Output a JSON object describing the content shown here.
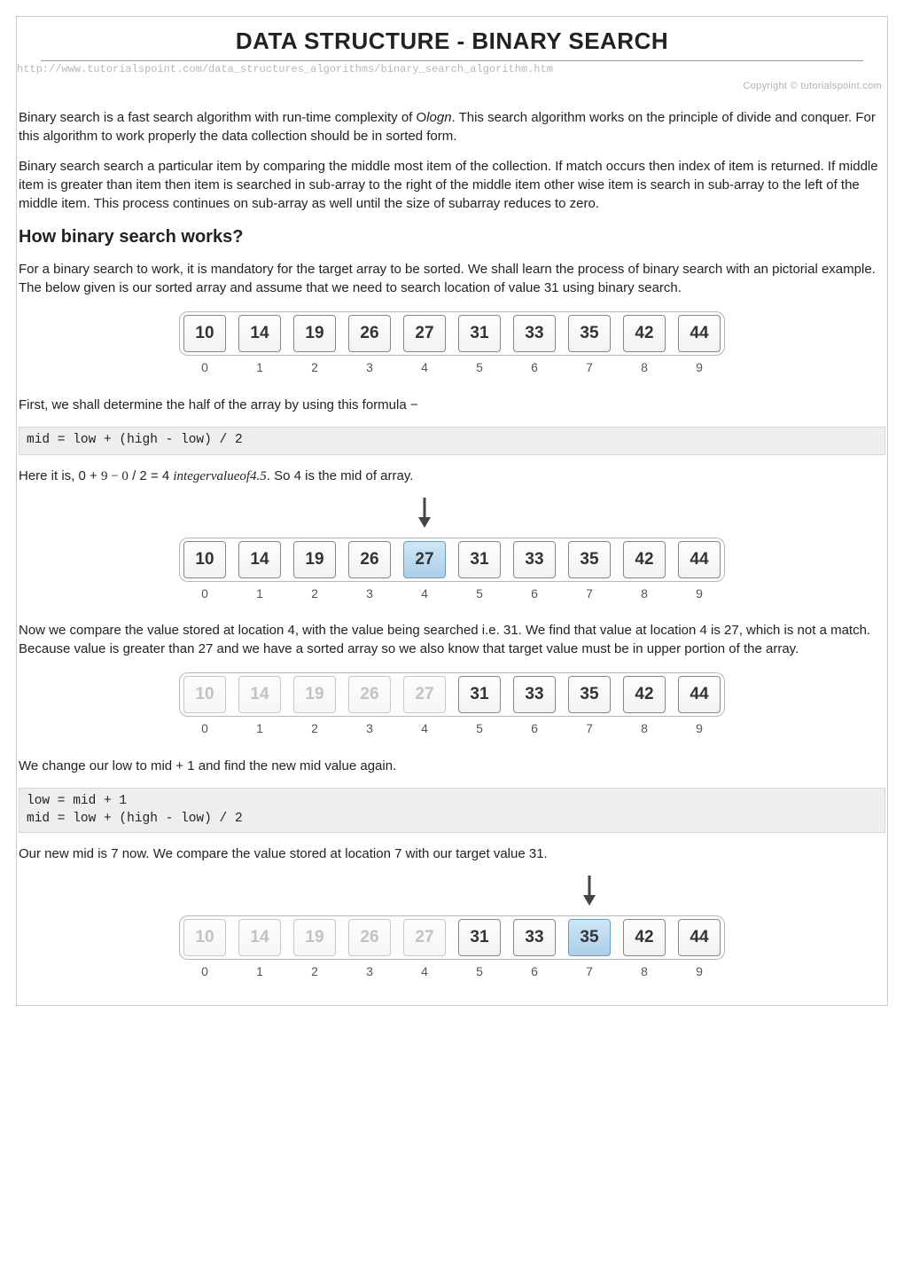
{
  "title": "DATA STRUCTURE - BINARY SEARCH",
  "url": "http://www.tutorialspoint.com/data_structures_algorithms/binary_search_algorithm.htm",
  "copyright": "Copyright © tutorialspoint.com",
  "p1a": "Binary search is a fast search algorithm with run-time complexity of Ο",
  "p1b": "logn",
  "p1c": ". This search algorithm works on the principle of divide and conquer. For this algorithm to work properly the data collection should be in sorted form.",
  "p2": "Binary search search a particular item by comparing the middle most item of the collection. If match occurs then index of item is returned. If middle item is greater than item then item is searched in sub-array to the right of the middle item other wise item is search in sub-array to the left of the middle item. This process continues on sub-array as well until the size of subarray reduces to zero.",
  "h2": "How binary search works?",
  "p3": "For a binary search to work, it is mandatory for the target array to be sorted. We shall learn the process of binary search with an pictorial example. The below given is our sorted array and assume that we need to search location of value 31 using binary search.",
  "p4": "First, we shall determine the half of the array by using this formula −",
  "code1": "mid = low + (high - low) / 2",
  "p5a": "Here it is, 0 + ",
  "p5b": "9 − 0",
  "p5c": " / 2 = 4 ",
  "p5d": "integervalueof4.5",
  "p5e": ". So 4 is the mid of array.",
  "p6": "Now we compare the value stored at location 4, with the value being searched i.e. 31. We find that value at location 4 is 27, which is not a match. Because value is greater than 27 and we have a sorted array so we also know that target value must be in upper portion of the array.",
  "p7": "We change our low to mid + 1 and find the new mid value again.",
  "code2": "low = mid + 1\nmid = low + (high - low) / 2",
  "p8": "Our new mid is 7 now. We compare the value stored at location 7 with our target value 31.",
  "array_values": [
    "10",
    "14",
    "19",
    "26",
    "27",
    "31",
    "33",
    "35",
    "42",
    "44"
  ],
  "array_indices": [
    "0",
    "1",
    "2",
    "3",
    "4",
    "5",
    "6",
    "7",
    "8",
    "9"
  ],
  "diagrams": [
    {
      "arrow": null,
      "highlight": null,
      "dim_until": null
    },
    {
      "arrow": 4,
      "highlight": 4,
      "dim_until": null
    },
    {
      "arrow": null,
      "highlight": null,
      "dim_until": 4
    },
    {
      "arrow": 7,
      "highlight": 7,
      "dim_until": 4
    }
  ]
}
